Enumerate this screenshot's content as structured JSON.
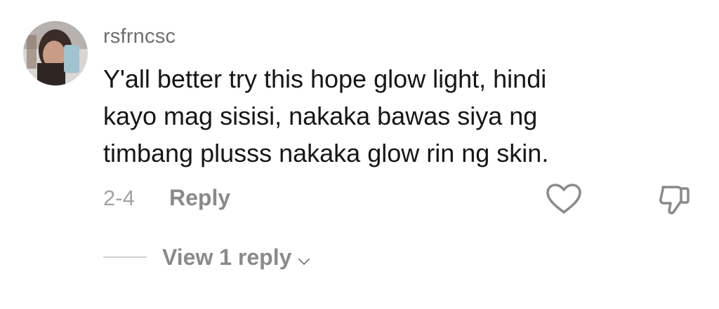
{
  "comment": {
    "username": "rsfrncsc",
    "text_lines": [
      "Y'all better try this hope glow light, hindi",
      "kayo mag sisisi, nakaka bawas siya ng",
      "timbang plusss nakaka glow rin ng skin."
    ],
    "date": "2-4",
    "reply_label": "Reply",
    "view_replies_label": "View 1 reply"
  },
  "icons": {
    "like": "heart-outline-icon",
    "dislike": "thumbs-down-outline-icon",
    "expand": "chevron-down-icon"
  },
  "colors": {
    "username": "#6f6f6f",
    "text": "#161616",
    "muted": "#8a8a8a",
    "date": "#a2a2a2"
  }
}
